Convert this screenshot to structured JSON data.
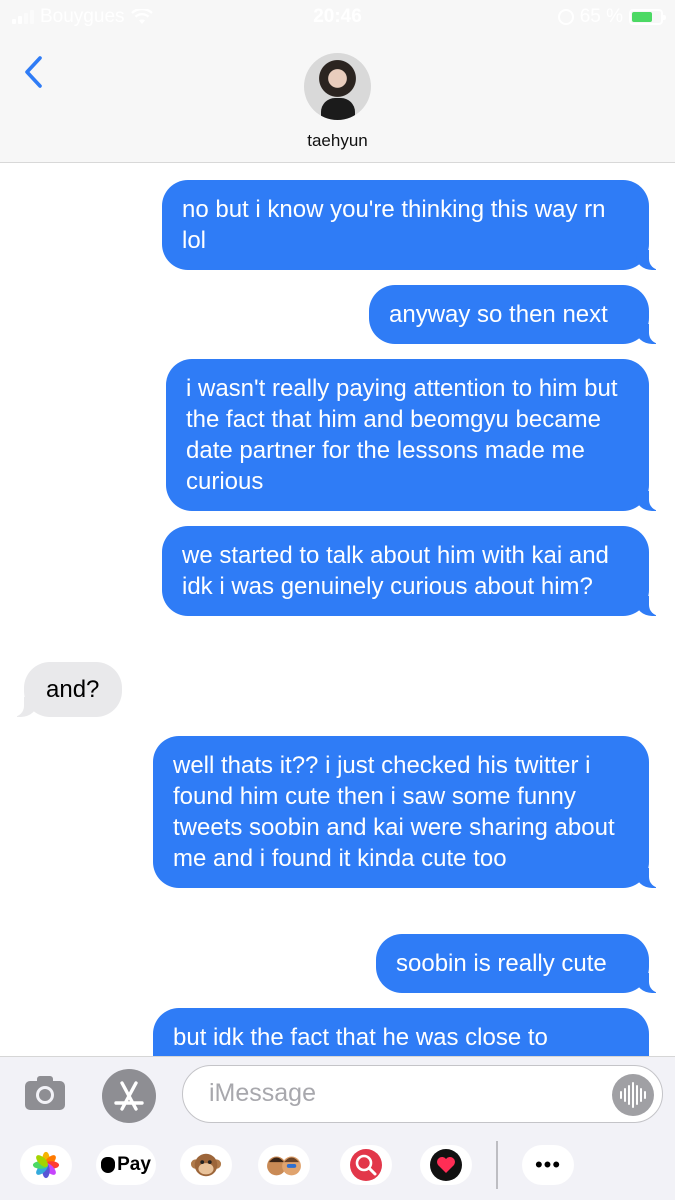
{
  "status_bar": {
    "carrier": "Bouygues",
    "time": "20:46",
    "battery_percent": "65 %",
    "battery_level": 0.65,
    "icons": [
      "signal-icon",
      "wifi-icon",
      "rotation-lock-icon",
      "battery-charging-icon"
    ]
  },
  "header": {
    "contact_name": "taehyun",
    "back_icon": "chevron-left-icon"
  },
  "messages": [
    {
      "from": "me",
      "text": "no but i know you're thinking this way rn lol"
    },
    {
      "from": "me",
      "text": "anyway so then next"
    },
    {
      "from": "me",
      "text": "i wasn't really paying attention to him but the fact that him and beomgyu became date partner for the lessons made me curious"
    },
    {
      "from": "me",
      "text": "we started to talk about him with kai and idk i was genuinely curious about him?"
    },
    {
      "from": "them",
      "text": "and?"
    },
    {
      "from": "me",
      "text": "well thats it?? i just checked his twitter i found him cute then i saw some funny tweets soobin and kai were sharing about me and i found it kinda cute too"
    },
    {
      "from": "me",
      "text": "soobin is really cute"
    },
    {
      "from": "me",
      "text": "but idk the fact that he was close to"
    }
  ],
  "compose": {
    "placeholder": "iMessage",
    "camera_icon": "camera-icon",
    "app_store_icon": "app-store-icon",
    "audio_icon": "audio-waveform-icon"
  },
  "app_drawer": [
    {
      "name": "photos-app-icon",
      "label": ""
    },
    {
      "name": "apple-pay-app",
      "label": "Pay"
    },
    {
      "name": "animoji-app-icon",
      "label": ""
    },
    {
      "name": "memoji-app-icon",
      "label": ""
    },
    {
      "name": "web-search-app-icon",
      "label": ""
    },
    {
      "name": "digital-touch-app-icon",
      "label": ""
    },
    {
      "name": "more-apps-icon",
      "label": "•••"
    }
  ],
  "colors": {
    "sent_bubble": "#2f7cf6",
    "received_bubble": "#e9e9eb",
    "accent": "#2f7cf6"
  }
}
